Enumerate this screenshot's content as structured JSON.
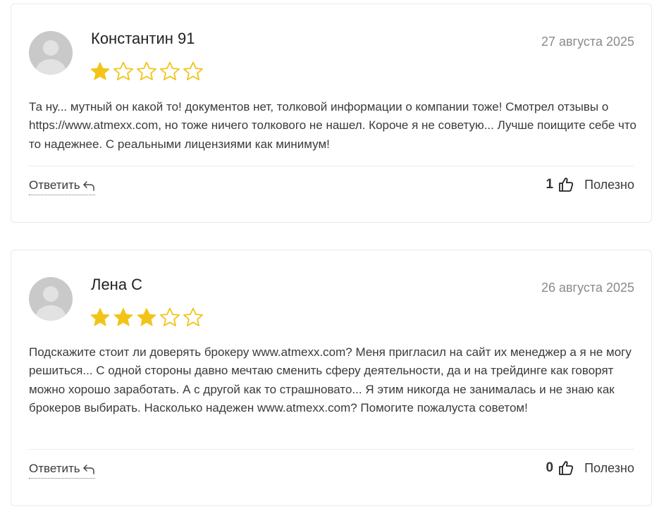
{
  "colors": {
    "star_filled": "#f2c418",
    "star_empty_stroke": "#f2c418",
    "avatar_bg": "#c9c9c9",
    "date_text": "#8a8a8a",
    "card_border": "#e9e9e9"
  },
  "reviews": [
    {
      "author": "Константин 91",
      "date": "27 августа 2025",
      "rating": 1,
      "max_rating": 5,
      "text": "Та ну... мутный он какой то! документов нет, толковой информации о компании тоже! Смотрел отзывы о https://www.atmexx.com, но тоже ничего толкового не нашел. Короче я не советую... Лучше поищите себе что то надежнее. С реальными лицензиями как минимум!",
      "reply_label": "Ответить",
      "likes": "1",
      "useful_label": "Полезно"
    },
    {
      "author": "Лена С",
      "date": "26 августа 2025",
      "rating": 3,
      "max_rating": 5,
      "text": "Подскажите стоит ли доверять брокеру www.atmexx.com? Меня пригласил на сайт их менеджер а я не могу решиться... С одной стороны давно мечтаю сменить сферу деятельности, да и на трейдинге как говорят можно хорошо заработать. А с другой как то страшновато... Я этим никогда не занималась и не знаю как брокеров выбирать. Насколько надежен www.atmexx.com? Помогите пожалуста советом!",
      "reply_label": "Ответить",
      "likes": "0",
      "useful_label": "Полезно"
    }
  ],
  "icons": {
    "avatar": "user-silhouette-icon",
    "star_filled": "star-filled-icon",
    "star_empty": "star-outline-icon",
    "reply": "reply-arrow-icon",
    "like": "thumbs-up-icon"
  }
}
